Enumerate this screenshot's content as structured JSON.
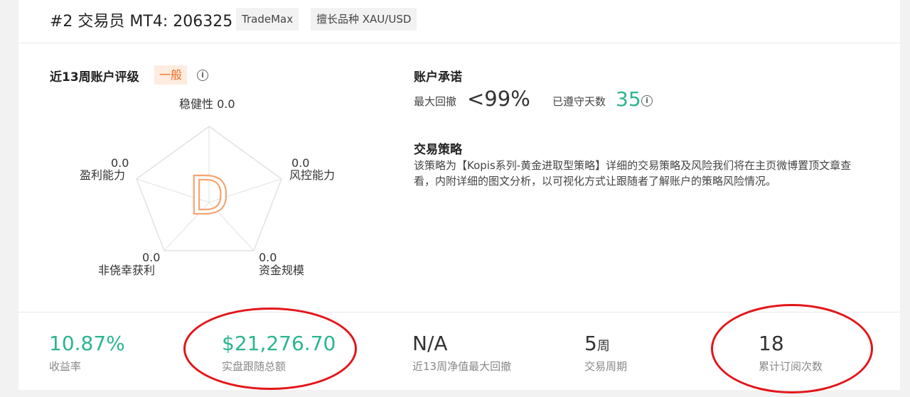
{
  "header": {
    "title": "#2 交易员 MT4: 206325",
    "broker_tag": "TradeMax",
    "specialty_tag": "擅长品种 XAU/USD"
  },
  "rating": {
    "title": "近13周账户评级",
    "level": "一般",
    "grade_letter": "D",
    "axes": [
      {
        "label": "稳健性",
        "value": "0.0"
      },
      {
        "label": "风控能力",
        "value": "0.0"
      },
      {
        "label": "资金规模",
        "value": "0.0"
      },
      {
        "label": "非侥幸获利",
        "value": "0.0"
      },
      {
        "label": "盈利能力",
        "value": "0.0"
      }
    ]
  },
  "promise": {
    "title": "账户承诺",
    "max_drawdown_label": "最大回撤",
    "max_drawdown_value": "<99%",
    "days_label": "已遵守天数",
    "days_value": "35"
  },
  "strategy": {
    "title": "交易策略",
    "text": "该策略为【Kopis系列-黄金进取型策略】详细的交易策略及风险我们将在主页微博置顶文章查看，内附详细的图文分析，以可视化方式让跟随者了解账户的策略风险情况。"
  },
  "stats": [
    {
      "value": "10.87%",
      "label": "收益率"
    },
    {
      "value": "$21,276.70",
      "label": "实盘跟随总额"
    },
    {
      "value": "N/A",
      "label": "近13周净值最大回撤"
    },
    {
      "value": "5",
      "unit": "周",
      "label": "交易周期"
    },
    {
      "value": "18",
      "label": "累计订阅次数"
    }
  ],
  "colors": {
    "green": "#2cb590",
    "orange": "#f06b25",
    "red_annotation": "#e3151a"
  }
}
